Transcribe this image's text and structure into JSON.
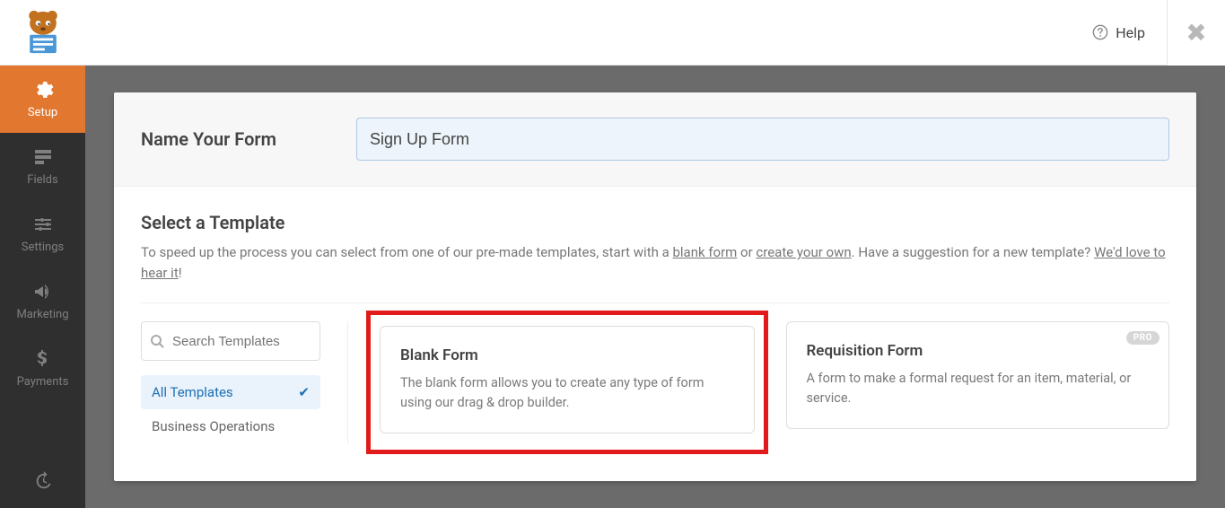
{
  "topbar": {
    "help_label": "Help"
  },
  "sidebar": {
    "items": [
      {
        "label": "Setup"
      },
      {
        "label": "Fields"
      },
      {
        "label": "Settings"
      },
      {
        "label": "Marketing"
      },
      {
        "label": "Payments"
      }
    ]
  },
  "form": {
    "name_label": "Name Your Form",
    "name_value": "Sign Up Form"
  },
  "templates": {
    "title": "Select a Template",
    "subtitle_prefix": "To speed up the process you can select from one of our pre-made templates, start with a ",
    "link_blank": "blank form",
    "subtitle_mid": " or ",
    "link_create": "create your own",
    "subtitle_mid2": ". Have a suggestion for a new template? ",
    "link_suggest": "We'd love to hear it",
    "subtitle_end": "!",
    "search_placeholder": "Search Templates",
    "categories": [
      {
        "label": "All Templates",
        "active": true
      },
      {
        "label": "Business Operations",
        "active": false
      }
    ],
    "cards": [
      {
        "title": "Blank Form",
        "desc": "The blank form allows you to create any type of form using our drag & drop builder.",
        "highlighted": true,
        "pro": false
      },
      {
        "title": "Requisition Form",
        "desc": "A form to make a formal request for an item, material, or service.",
        "highlighted": false,
        "pro": true,
        "pro_label": "PRO"
      }
    ]
  }
}
